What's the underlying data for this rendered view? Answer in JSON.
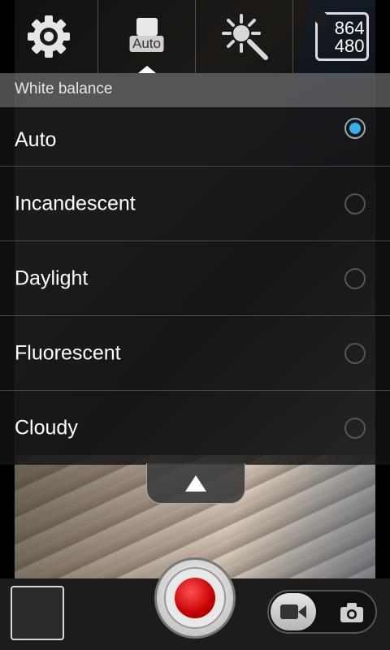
{
  "top_bar": {
    "settings_icon": "gear-icon",
    "white_balance": {
      "icon": "white-balance-icon",
      "label": "Auto"
    },
    "exposure_icon": "exposure-icon",
    "resolution": {
      "width": "864",
      "height": "480"
    }
  },
  "white_balance_panel": {
    "title": "White balance",
    "options": [
      {
        "label": "Auto",
        "selected": true
      },
      {
        "label": "Incandescent",
        "selected": false
      },
      {
        "label": "Daylight",
        "selected": false
      },
      {
        "label": "Fluorescent",
        "selected": false
      },
      {
        "label": "Cloudy",
        "selected": false
      }
    ],
    "collapse_icon": "chevron-up-icon"
  },
  "bottom_bar": {
    "thumbnail": "last-capture-thumbnail",
    "shutter_icon": "record-icon",
    "mode_switch": {
      "video_icon": "video-camera-icon",
      "photo_icon": "camera-icon",
      "selected": "video"
    }
  },
  "colors": {
    "accent": "#35b0e8",
    "record": "#d40000"
  }
}
